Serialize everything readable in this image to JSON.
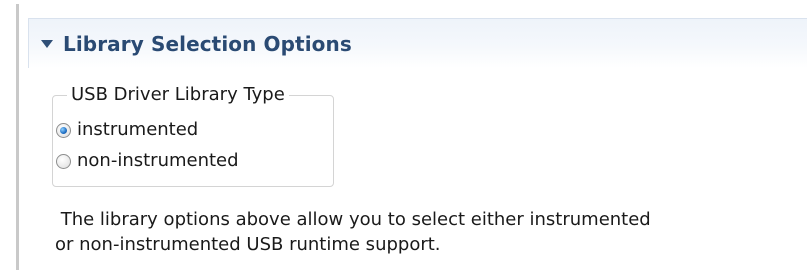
{
  "section": {
    "title": "Library Selection Options",
    "expanded": true,
    "twisty_icon": "triangle-down-icon",
    "title_color": "#2a4a73"
  },
  "group": {
    "legend": "USB Driver Library Type",
    "options": [
      {
        "label": "instrumented",
        "selected": true
      },
      {
        "label": "non-instrumented",
        "selected": false
      }
    ]
  },
  "description": {
    "line1": " The library options above allow you to select either instrumented",
    "line2": "or non-instrumented USB runtime support."
  }
}
